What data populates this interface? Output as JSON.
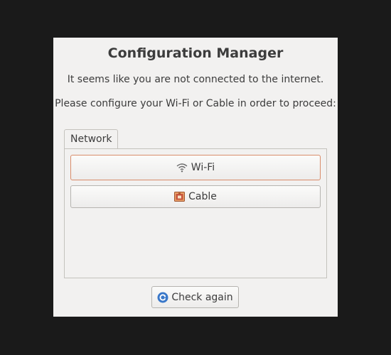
{
  "dialog": {
    "title": "Configuration Manager",
    "message_line1": "It seems like you are not connected to the internet.",
    "message_line2": "Please configure your Wi-Fi or Cable in order to proceed:"
  },
  "tabs": [
    {
      "label": "Network",
      "selected": true
    }
  ],
  "network": {
    "wifi_button": {
      "label": "Wi-Fi",
      "icon": "wifi-icon"
    },
    "cable_button": {
      "label": "Cable",
      "icon": "ethernet-icon"
    }
  },
  "footer": {
    "check_button": {
      "label": "Check again",
      "icon": "refresh-icon"
    }
  },
  "colors": {
    "background": "#1a1a1a",
    "dialog_bg": "#f2f1f0",
    "text": "#3c3c3c",
    "focus_border": "#d98c6a",
    "refresh_icon": "#3a78c9",
    "cable_icon": "#c8553d"
  }
}
